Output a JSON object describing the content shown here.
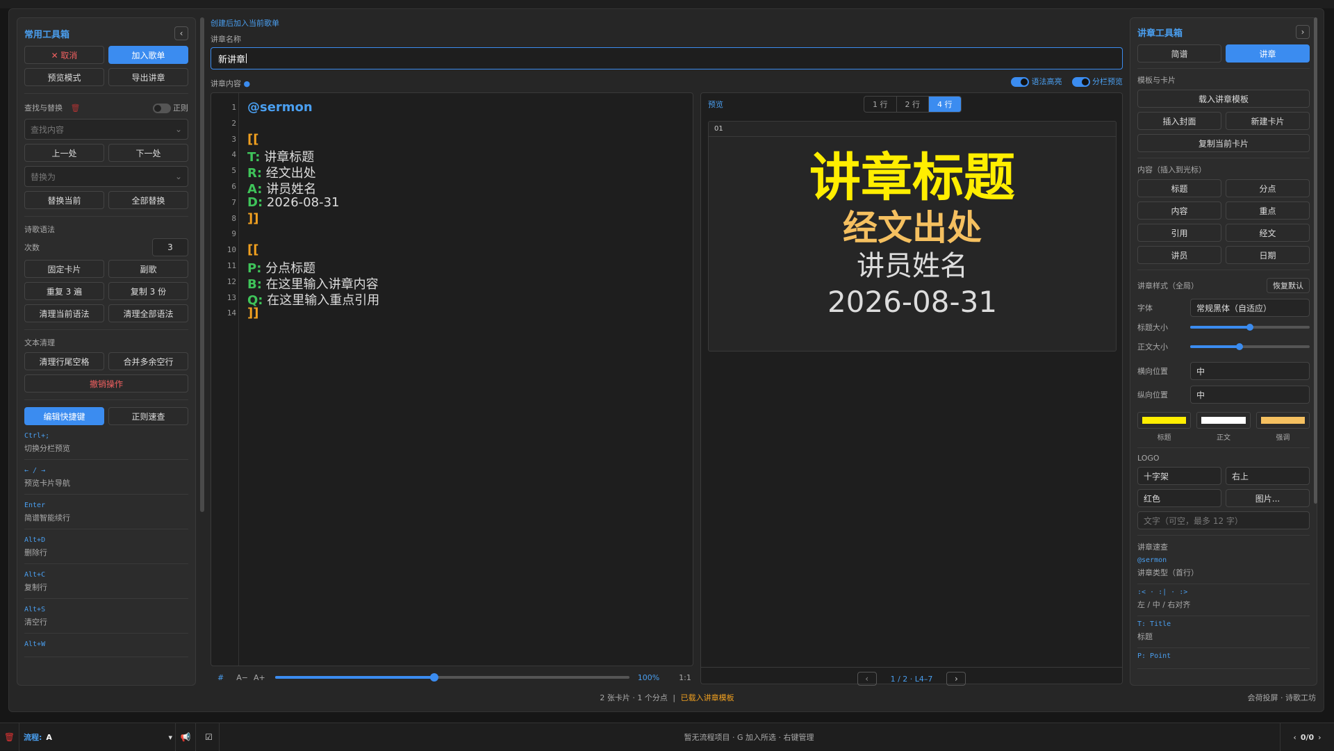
{
  "left": {
    "title": "常用工具箱",
    "collapse_icon": "‹",
    "cancel_label": "✕  取消",
    "add_playlist_label": "加入歌单",
    "preview_mode_label": "预览模式",
    "export_label": "导出讲章",
    "find_replace_title": "查找与替换",
    "regex_label": "正则",
    "find_placeholder": "查找内容",
    "prev_label": "上一处",
    "next_label": "下一处",
    "replace_placeholder": "替换为",
    "replace_current_label": "替换当前",
    "replace_all_label": "全部替换",
    "poem_syntax_title": "诗歌语法",
    "times_label": "次数",
    "times_value": "3",
    "fixed_card_label": "固定卡片",
    "chorus_label": "副歌",
    "repeat_label": "重复 3 遍",
    "copy_label": "复制 3 份",
    "clear_current_label": "清理当前语法",
    "clear_all_label": "清理全部语法",
    "text_clean_title": "文本清理",
    "trim_trailing_label": "清理行尾空格",
    "merge_blank_label": "合并多余空行",
    "undo_label": "撤销操作",
    "edit_shortcuts_label": "编辑快捷键",
    "regex_quick_label": "正则速查",
    "shortcuts": [
      {
        "key": "Ctrl+;",
        "desc": "切换分栏预览"
      },
      {
        "key": "← / →",
        "desc": "预览卡片导航"
      },
      {
        "key": "Enter",
        "desc": "简谱智能续行"
      },
      {
        "key": "Alt+D",
        "desc": "删除行"
      },
      {
        "key": "Alt+C",
        "desc": "复制行"
      },
      {
        "key": "Alt+S",
        "desc": "清空行"
      },
      {
        "key": "Alt+W",
        "desc": ""
      }
    ]
  },
  "center": {
    "hint_link": "创建后加入当前歌单",
    "name_label": "讲章名称",
    "name_value": "新讲章",
    "content_label": "讲章内容",
    "syntax_highlight_label": "语法高亮",
    "split_preview_label": "分栏预览",
    "code_lines": [
      {
        "n": "1",
        "k": "@sermon",
        "t": ""
      },
      {
        "n": "2",
        "k": "",
        "t": ""
      },
      {
        "n": "3",
        "k": "[[",
        "t": ""
      },
      {
        "n": "4",
        "k": "T:",
        "t": " 讲章标题"
      },
      {
        "n": "5",
        "k": "R:",
        "t": " 经文出处"
      },
      {
        "n": "6",
        "k": "A:",
        "t": " 讲员姓名"
      },
      {
        "n": "7",
        "k": "D:",
        "t": " 2026-08-31"
      },
      {
        "n": "8",
        "k": "]]",
        "t": ""
      },
      {
        "n": "9",
        "k": "",
        "t": ""
      },
      {
        "n": "10",
        "k": "[[",
        "t": ""
      },
      {
        "n": "11",
        "k": "P:",
        "t": " 分点标题"
      },
      {
        "n": "12",
        "k": "B:",
        "t": " 在这里输入讲章内容"
      },
      {
        "n": "13",
        "k": "Q:",
        "t": " 在这里输入重点引用"
      },
      {
        "n": "14",
        "k": "]]",
        "t": ""
      }
    ],
    "footer": {
      "hash": "#",
      "font_down": "A−",
      "font_up": "A+",
      "zoom": "100%",
      "ratio": "1:1",
      "zoom_fraction": 0.45
    }
  },
  "preview": {
    "title": "预览",
    "tabs": [
      "1 行",
      "2 行",
      "4 行"
    ],
    "active_tab": "4 行",
    "card_index": "01",
    "card_title": "讲章标题",
    "card_ref": "经文出处",
    "card_author": "讲员姓名",
    "card_date": "2026-08-31",
    "pager_prev": "‹",
    "pager_text": "1 / 2 · L4–7",
    "pager_next": "›"
  },
  "right": {
    "title": "讲章工具箱",
    "expand_icon": "›",
    "tab_simple": "简谱",
    "tab_sermon": "讲章",
    "templates_title": "模板与卡片",
    "load_template_label": "载入讲章模板",
    "insert_cover_label": "插入封面",
    "new_card_label": "新建卡片",
    "copy_card_label": "复制当前卡片",
    "content_title": "内容（插入到光标）",
    "content_buttons": [
      "标题",
      "分点",
      "内容",
      "重点",
      "引用",
      "经文",
      "讲员",
      "日期"
    ],
    "style_title": "讲章样式（全局）",
    "reset_label": "恢复默认",
    "font_label": "字体",
    "font_value": "常规黑体（自适应）",
    "title_size_label": "标题大小",
    "title_size_fraction": 0.5,
    "body_size_label": "正文大小",
    "body_size_fraction": 0.41,
    "h_pos_label": "横向位置",
    "h_pos_value": "中",
    "v_pos_label": "纵向位置",
    "v_pos_value": "中",
    "swatches": [
      {
        "label": "标题",
        "color": "#ffee00"
      },
      {
        "label": "正文",
        "color": "#ffffff"
      },
      {
        "label": "强调",
        "color": "#f5c060"
      }
    ],
    "logo_title": "LOGO",
    "logo_cross": "十字架",
    "logo_pos": "右上",
    "logo_color": "红色",
    "logo_image": "图片...",
    "logo_text_placeholder": "文字（可空，最多 12 字）",
    "quick_title": "讲章速查",
    "quick": [
      {
        "key": "@sermon",
        "desc": "讲章类型（首行）"
      },
      {
        "key": ":< · :| · :>",
        "desc": "左 / 中 / 右对齐"
      },
      {
        "key": "T: Title",
        "desc": "标题"
      },
      {
        "key": "P: Point",
        "desc": ""
      }
    ]
  },
  "status": {
    "summary": "2 张卡片 · 1 个分点",
    "loaded": "已载入讲章模板",
    "brand": "会荷投屏 · 诗歌工坊"
  },
  "bottom": {
    "flow_label": "流程:",
    "flow_value": "A",
    "center_text": "暂无流程项目 · G 加入所选 · 右键管理",
    "count": "0/0"
  },
  "colors": {
    "accent": "#3b8cf0",
    "keyword_green": "#3fc45a",
    "keyword_blue": "#4a9ff0",
    "bracket_orange": "#f0a020",
    "card_title_yellow": "#ffee00",
    "card_ref_orange": "#f5c060"
  }
}
